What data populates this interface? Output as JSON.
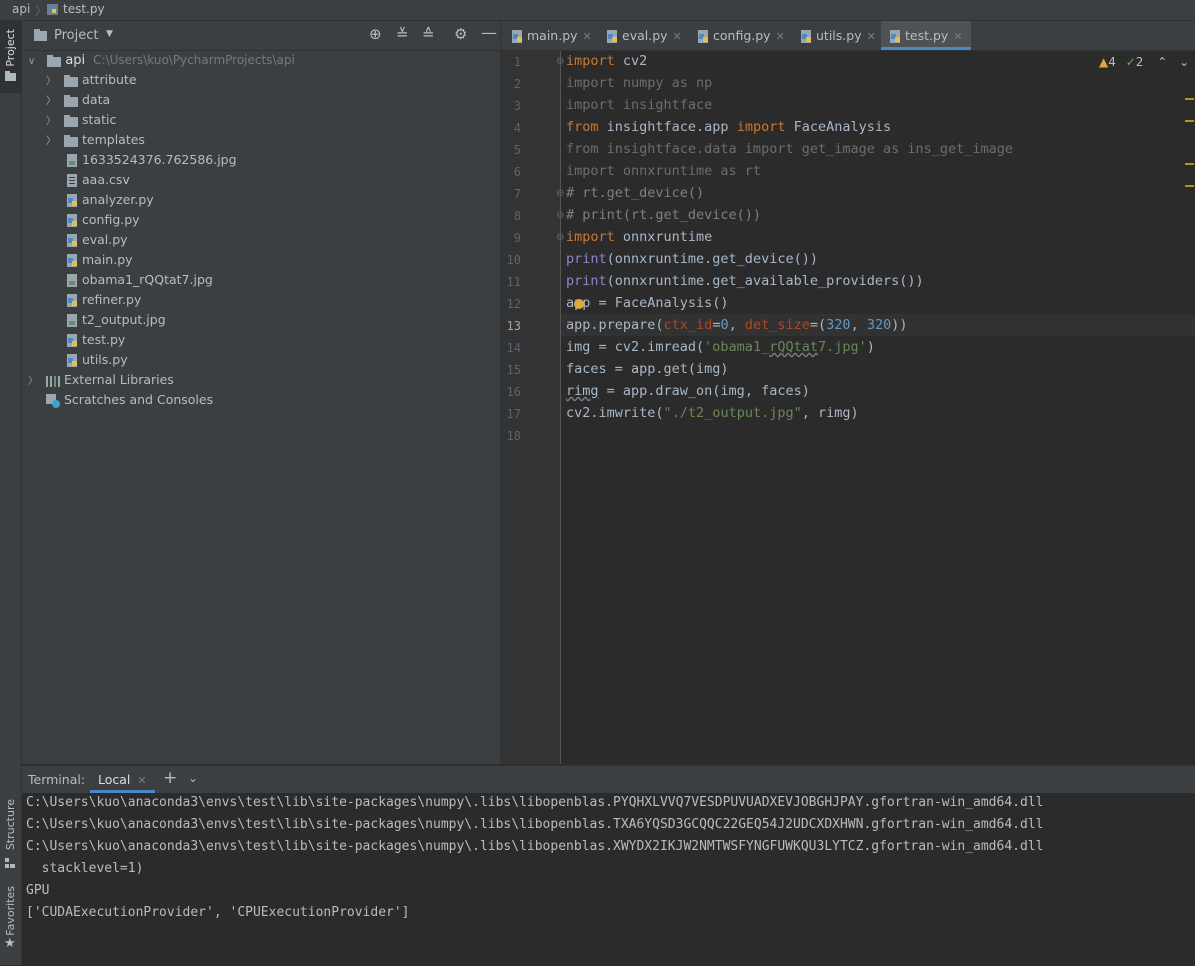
{
  "breadcrumb": {
    "root": "api",
    "file": "test.py"
  },
  "left_strip": {
    "project": "Project",
    "structure": "Structure",
    "favorites": "Favorites"
  },
  "project_panel": {
    "title": "Project",
    "root_name": "api",
    "root_path": "C:\\Users\\kuo\\PycharmProjects\\api",
    "folders": [
      "attribute",
      "data",
      "static",
      "templates"
    ],
    "files": [
      {
        "name": "1633524376.762586.jpg",
        "type": "image"
      },
      {
        "name": "aaa.csv",
        "type": "text"
      },
      {
        "name": "analyzer.py",
        "type": "python"
      },
      {
        "name": "config.py",
        "type": "python"
      },
      {
        "name": "eval.py",
        "type": "python"
      },
      {
        "name": "main.py",
        "type": "python"
      },
      {
        "name": "obama1_rQQtat7.jpg",
        "type": "image"
      },
      {
        "name": "refiner.py",
        "type": "python"
      },
      {
        "name": "t2_output.jpg",
        "type": "image"
      },
      {
        "name": "test.py",
        "type": "python"
      },
      {
        "name": "utils.py",
        "type": "python"
      }
    ],
    "external_libraries": "External Libraries",
    "scratches": "Scratches and Consoles"
  },
  "tabs": [
    {
      "label": "main.py",
      "active": false
    },
    {
      "label": "eval.py",
      "active": false
    },
    {
      "label": "config.py",
      "active": false
    },
    {
      "label": "utils.py",
      "active": false
    },
    {
      "label": "test.py",
      "active": true
    }
  ],
  "inspections": {
    "warnings": "4",
    "weak_warnings": "2"
  },
  "line_numbers": [
    "1",
    "2",
    "3",
    "4",
    "5",
    "6",
    "7",
    "8",
    "9",
    "10",
    "11",
    "12",
    "13",
    "14",
    "15",
    "16",
    "17",
    "18"
  ],
  "current_line": "13",
  "terminal": {
    "title": "Terminal:",
    "tab": "Local",
    "lines": [
      "C:\\Users\\kuo\\anaconda3\\envs\\test\\lib\\site-packages\\numpy\\.libs\\libopenblas.PYQHXLVVQ7VESDPUVUADXEVJOBGHJPAY.gfortran-win_amd64.dll",
      "C:\\Users\\kuo\\anaconda3\\envs\\test\\lib\\site-packages\\numpy\\.libs\\libopenblas.TXA6YQSD3GCQQC22GEQ54J2UDCXDXHWN.gfortran-win_amd64.dll",
      "C:\\Users\\kuo\\anaconda3\\envs\\test\\lib\\site-packages\\numpy\\.libs\\libopenblas.XWYDX2IKJW2NMTWSFYNGFUWKQU3LYTCZ.gfortran-win_amd64.dll",
      "  stacklevel=1)",
      "GPU",
      "['CUDAExecutionProvider', 'CPUExecutionProvider']"
    ]
  },
  "colors": {
    "accent": "#4a88c7",
    "keyword": "#cc7832",
    "string": "#6a8759",
    "number": "#6897bb",
    "builtin": "#8888c6",
    "param": "#aa4926",
    "warning": "#e0a83a"
  }
}
